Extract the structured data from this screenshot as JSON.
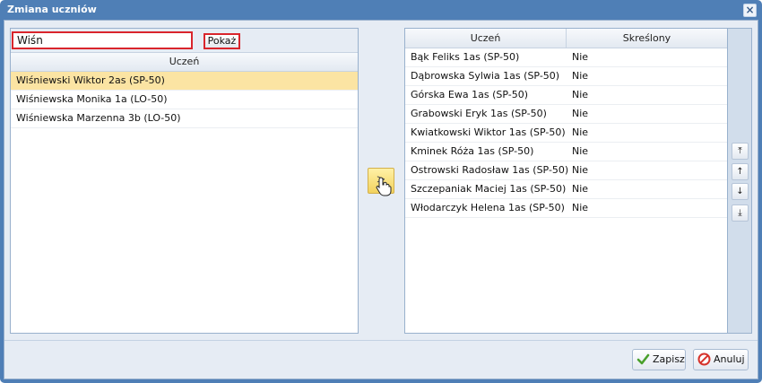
{
  "dialog": {
    "title": "Zmiana uczniów"
  },
  "search": {
    "value": "Wiśn",
    "button_label": "Pokaż"
  },
  "left_list": {
    "header": "Uczeń",
    "items": [
      "Wiśniewski Wiktor 2as (SP-50)",
      "Wiśniewska Monika 1a (LO-50)",
      "Wiśniewska Marzenna 3b (LO-50)"
    ],
    "selected_index": 0
  },
  "move": {
    "label": ">"
  },
  "right_table": {
    "headers": [
      "Uczeń",
      "Skreślony"
    ],
    "rows": [
      [
        "Bąk Feliks 1as (SP-50)",
        "Nie"
      ],
      [
        "Dąbrowska Sylwia 1as (SP-50)",
        "Nie"
      ],
      [
        "Górska Ewa 1as (SP-50)",
        "Nie"
      ],
      [
        "Grabowski Eryk 1as (SP-50)",
        "Nie"
      ],
      [
        "Kwiatkowski Wiktor 1as (SP-50)",
        "Nie"
      ],
      [
        "Kminek Róża 1as (SP-50)",
        "Nie"
      ],
      [
        "Ostrowski Radosław 1as (SP-50)",
        "Nie"
      ],
      [
        "Szczepaniak Maciej 1as (SP-50)",
        "Nie"
      ],
      [
        "Włodarczyk Helena 1as (SP-50)",
        "Nie"
      ]
    ]
  },
  "order_buttons": {
    "top": "⤒",
    "up": "↑",
    "down": "↓",
    "bottom": "⤓"
  },
  "footer": {
    "save_label": "Zapisz",
    "cancel_label": "Anuluj"
  }
}
